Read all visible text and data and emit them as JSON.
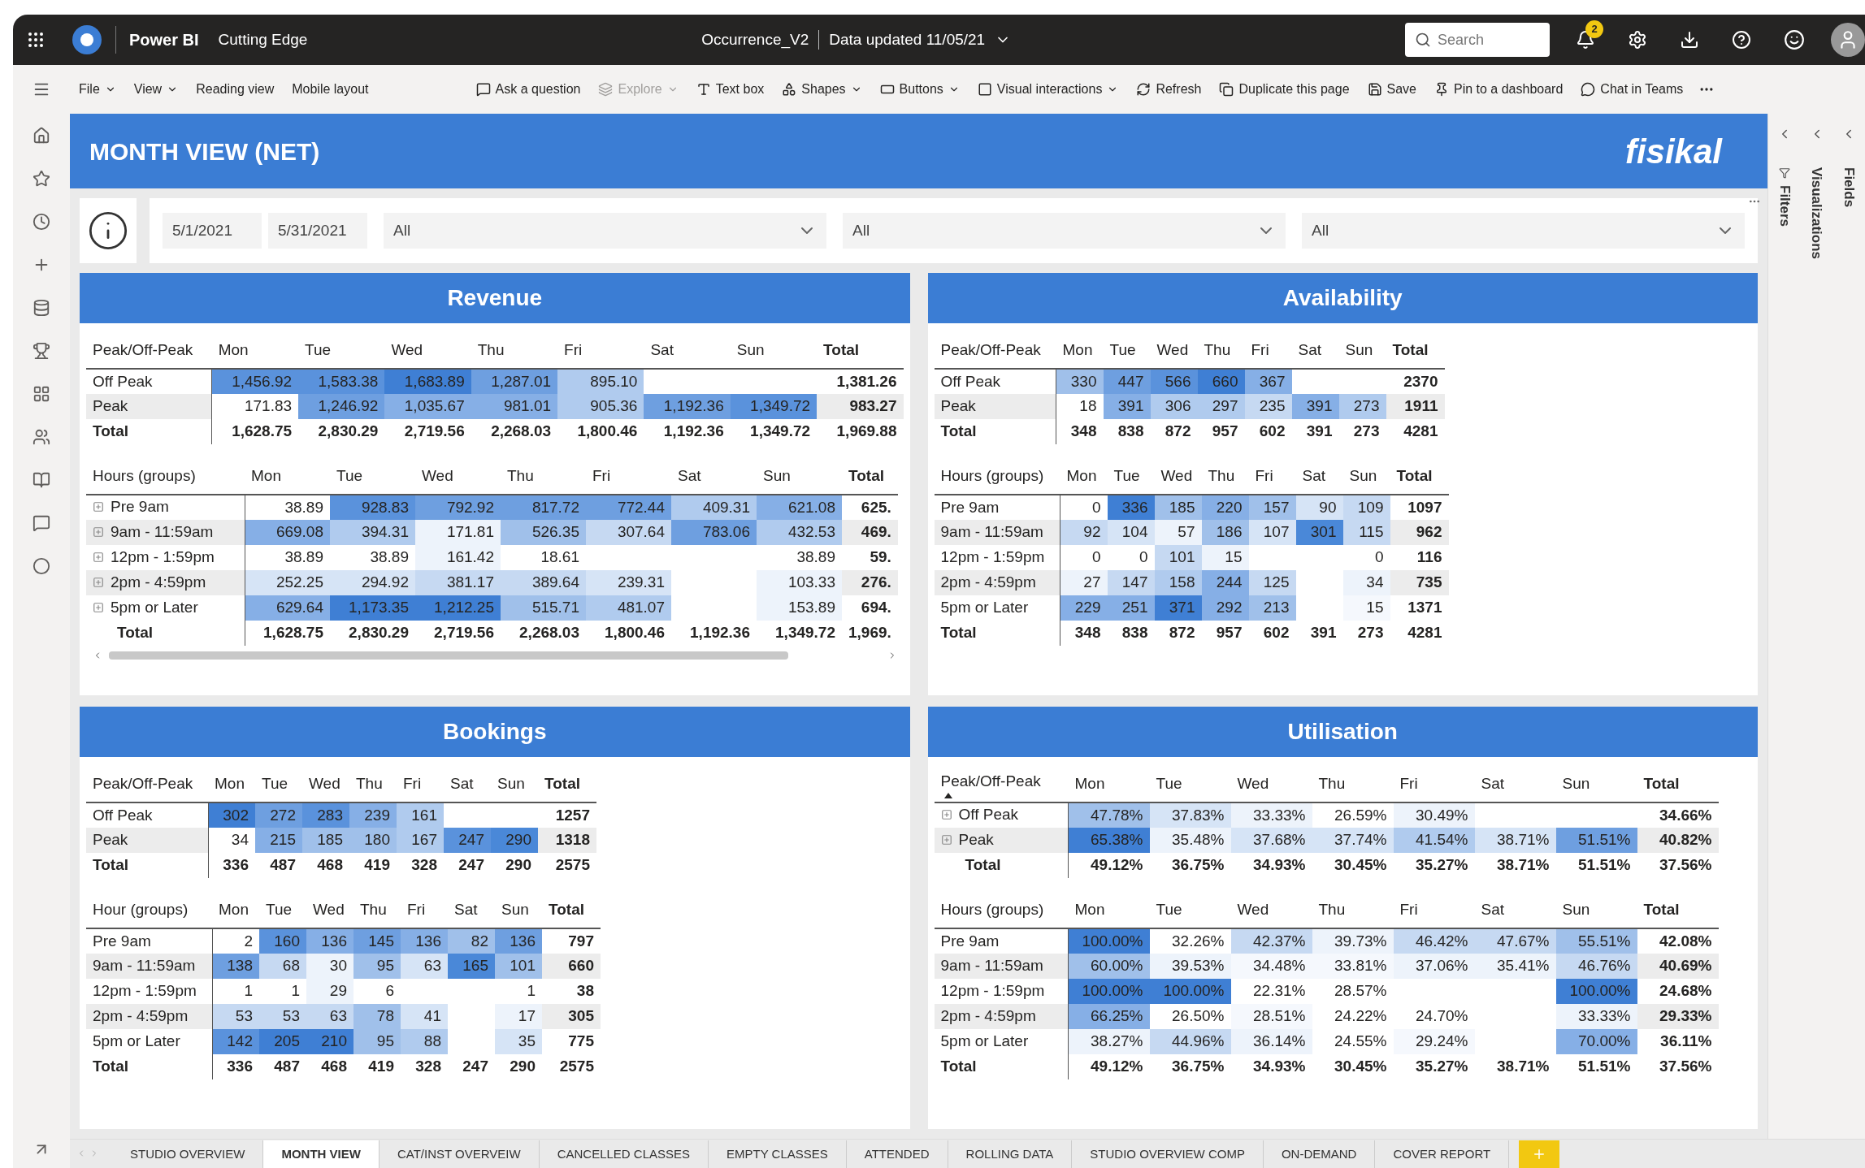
{
  "app_bar": {
    "app_name": "Power BI",
    "workspace": "Cutting Edge",
    "report_title": "Occurrence_V2",
    "data_updated": "Data updated 11/05/21",
    "search_placeholder": "Search",
    "notification_count": "2"
  },
  "toolbar": [
    {
      "label": "File",
      "dropdown": true,
      "disabled": false,
      "kind": "menu"
    },
    {
      "label": "View",
      "dropdown": true,
      "disabled": false,
      "kind": "menu"
    },
    {
      "label": "Reading view",
      "dropdown": false,
      "disabled": false,
      "kind": "menu"
    },
    {
      "label": "Mobile layout",
      "dropdown": false,
      "disabled": false,
      "kind": "menu"
    },
    {
      "label": "Ask a question",
      "dropdown": false,
      "disabled": false,
      "kind": "ask"
    },
    {
      "label": "Explore",
      "dropdown": true,
      "disabled": true,
      "kind": "explore"
    },
    {
      "label": "Text box",
      "dropdown": false,
      "disabled": false,
      "kind": "textbox"
    },
    {
      "label": "Shapes",
      "dropdown": true,
      "disabled": false,
      "kind": "shapes"
    },
    {
      "label": "Buttons",
      "dropdown": true,
      "disabled": false,
      "kind": "buttons"
    },
    {
      "label": "Visual interactions",
      "dropdown": true,
      "disabled": false,
      "kind": "interactions"
    },
    {
      "label": "Refresh",
      "dropdown": false,
      "disabled": false,
      "kind": "refresh"
    },
    {
      "label": "Duplicate this page",
      "dropdown": false,
      "disabled": false,
      "kind": "duplicate"
    },
    {
      "label": "Save",
      "dropdown": false,
      "disabled": false,
      "kind": "save"
    },
    {
      "label": "Pin to a dashboard",
      "dropdown": false,
      "disabled": false,
      "kind": "pin"
    },
    {
      "label": "Chat in Teams",
      "dropdown": false,
      "disabled": false,
      "kind": "teams"
    }
  ],
  "report_header": {
    "title": "MONTH VIEW (NET)",
    "logo": "fisikal"
  },
  "filters": {
    "start_date": "5/1/2021",
    "end_date": "5/31/2021",
    "dropdowns": [
      "All",
      "All",
      "All"
    ]
  },
  "panels": [
    {
      "title": "Revenue",
      "tables": [
        {
          "columns": [
            "Peak/Off-Peak",
            "Mon",
            "Tue",
            "Wed",
            "Thu",
            "Fri",
            "Sat",
            "Sun",
            "Total"
          ],
          "expand_icons": false,
          "sort_indicator": false,
          "scrollbar": false,
          "rows": [
            {
              "cells": [
                {
                  "text": "Off Peak"
                },
                {
                  "text": "1,456.92",
                  "color": "#5a92dc"
                },
                {
                  "text": "1,583.38",
                  "color": "#5a92dc"
                },
                {
                  "text": "1,683.89",
                  "color": "#3f7fd4"
                },
                {
                  "text": "1,287.01",
                  "color": "#6e9fe0"
                },
                {
                  "text": "895.10",
                  "color": "#b0cbee"
                },
                "",
                "",
                {
                  "text": "1,381.26"
                }
              ]
            },
            {
              "cells": [
                {
                  "text": "Peak"
                },
                {
                  "text": "171.83"
                },
                {
                  "text": "1,246.92",
                  "color": "#6e9fe0"
                },
                {
                  "text": "1,035.67",
                  "color": "#86afe6"
                },
                {
                  "text": "981.01",
                  "color": "#86afe6"
                },
                {
                  "text": "905.36",
                  "color": "#b0cbee"
                },
                {
                  "text": "1,192.36",
                  "color": "#6e9fe0"
                },
                {
                  "text": "1,349.72",
                  "color": "#5a92dc"
                },
                {
                  "text": "983.27"
                }
              ]
            }
          ],
          "total_row": [
            "Total",
            "1,628.75",
            "2,830.29",
            "2,719.56",
            "2,268.03",
            "1,800.46",
            "1,192.36",
            "1,349.72",
            "1,969.88"
          ]
        },
        {
          "columns": [
            "Hours (groups)",
            "Mon",
            "Tue",
            "Wed",
            "Thu",
            "Fri",
            "Sat",
            "Sun",
            "Total"
          ],
          "expand_icons": true,
          "sort_indicator": false,
          "scrollbar": true,
          "rows": [
            {
              "cells": [
                {
                  "text": "Pre 9am"
                },
                {
                  "text": "38.89"
                },
                {
                  "text": "928.83",
                  "color": "#5a92dc"
                },
                {
                  "text": "792.92",
                  "color": "#6e9fe0"
                },
                {
                  "text": "817.72",
                  "color": "#6e9fe0"
                },
                {
                  "text": "772.44",
                  "color": "#6e9fe0"
                },
                {
                  "text": "409.31",
                  "color": "#b0cbee"
                },
                {
                  "text": "621.08",
                  "color": "#86afe6"
                },
                {
                  "text": "625."
                }
              ]
            },
            {
              "cells": [
                {
                  "text": "9am - 11:59am"
                },
                {
                  "text": "669.08",
                  "color": "#86afe6"
                },
                {
                  "text": "394.31",
                  "color": "#b0cbee"
                },
                {
                  "text": "171.81",
                  "color": "#edf3fb"
                },
                {
                  "text": "526.35",
                  "color": "#a0c0ea"
                },
                {
                  "text": "307.64",
                  "color": "#c6d9f2"
                },
                {
                  "text": "783.06",
                  "color": "#6e9fe0"
                },
                {
                  "text": "432.53",
                  "color": "#b0cbee"
                },
                {
                  "text": "469."
                }
              ]
            },
            {
              "cells": [
                {
                  "text": "12pm - 1:59pm"
                },
                {
                  "text": "38.89"
                },
                {
                  "text": "38.89"
                },
                {
                  "text": "161.42",
                  "color": "#edf3fb"
                },
                {
                  "text": "18.61"
                },
                "",
                "",
                {
                  "text": "38.89"
                },
                {
                  "text": "59."
                }
              ]
            },
            {
              "cells": [
                {
                  "text": "2pm - 4:59pm"
                },
                {
                  "text": "252.25",
                  "color": "#d6e4f6"
                },
                {
                  "text": "294.92",
                  "color": "#d6e4f6"
                },
                {
                  "text": "381.17",
                  "color": "#c6d9f2"
                },
                {
                  "text": "389.64",
                  "color": "#c6d9f2"
                },
                {
                  "text": "239.31",
                  "color": "#d6e4f6"
                },
                "",
                {
                  "text": "103.33",
                  "color": "#edf3fb"
                },
                {
                  "text": "276."
                }
              ]
            },
            {
              "cells": [
                {
                  "text": "5pm or Later"
                },
                {
                  "text": "629.64",
                  "color": "#86afe6"
                },
                {
                  "text": "1,173.35",
                  "color": "#3f7fd4"
                },
                {
                  "text": "1,212.25",
                  "color": "#3f7fd4"
                },
                {
                  "text": "515.71",
                  "color": "#a0c0ea"
                },
                {
                  "text": "481.07",
                  "color": "#b0cbee"
                },
                "",
                {
                  "text": "153.89",
                  "color": "#edf3fb"
                },
                {
                  "text": "694."
                }
              ]
            }
          ],
          "total_row": [
            "Total",
            "1,628.75",
            "2,830.29",
            "2,719.56",
            "2,268.03",
            "1,800.46",
            "1,192.36",
            "1,349.72",
            "1,969."
          ]
        }
      ]
    },
    {
      "title": "Availability",
      "tables": [
        {
          "columns": [
            "Peak/Off-Peak",
            "Mon",
            "Tue",
            "Wed",
            "Thu",
            "Fri",
            "Sat",
            "Sun",
            "Total"
          ],
          "expand_icons": false,
          "sort_indicator": false,
          "scrollbar": false,
          "rows": [
            {
              "cells": [
                {
                  "text": "Off Peak"
                },
                {
                  "text": "330",
                  "color": "#a0c0ea"
                },
                {
                  "text": "447",
                  "color": "#6e9fe0"
                },
                {
                  "text": "566",
                  "color": "#5a92dc"
                },
                {
                  "text": "660",
                  "color": "#3f7fd4"
                },
                {
                  "text": "367",
                  "color": "#86afe6"
                },
                "",
                "",
                {
                  "text": "2370"
                }
              ]
            },
            {
              "cells": [
                {
                  "text": "Peak"
                },
                {
                  "text": "18"
                },
                {
                  "text": "391",
                  "color": "#86afe6"
                },
                {
                  "text": "306",
                  "color": "#b0cbee"
                },
                {
                  "text": "297",
                  "color": "#b0cbee"
                },
                {
                  "text": "235",
                  "color": "#c6d9f2"
                },
                {
                  "text": "391",
                  "color": "#86afe6"
                },
                {
                  "text": "273",
                  "color": "#b0cbee"
                },
                {
                  "text": "1911"
                }
              ]
            }
          ],
          "total_row": [
            "Total",
            "348",
            "838",
            "872",
            "957",
            "602",
            "391",
            "273",
            "4281"
          ]
        },
        {
          "columns": [
            "Hours (groups)",
            "Mon",
            "Tue",
            "Wed",
            "Thu",
            "Fri",
            "Sat",
            "Sun",
            "Total"
          ],
          "expand_icons": false,
          "sort_indicator": false,
          "scrollbar": false,
          "rows": [
            {
              "cells": [
                {
                  "text": "Pre 9am"
                },
                {
                  "text": "0"
                },
                {
                  "text": "336",
                  "color": "#3f7fd4"
                },
                {
                  "text": "185",
                  "color": "#a0c0ea"
                },
                {
                  "text": "220",
                  "color": "#86afe6"
                },
                {
                  "text": "157",
                  "color": "#a0c0ea"
                },
                {
                  "text": "90",
                  "color": "#d6e4f6"
                },
                {
                  "text": "109",
                  "color": "#c6d9f2"
                },
                {
                  "text": "1097"
                }
              ]
            },
            {
              "cells": [
                {
                  "text": "9am - 11:59am"
                },
                {
                  "text": "92",
                  "color": "#c6d9f2"
                },
                {
                  "text": "104",
                  "color": "#d6e4f6"
                },
                {
                  "text": "57",
                  "color": "#edf3fb"
                },
                {
                  "text": "186",
                  "color": "#a0c0ea"
                },
                {
                  "text": "107",
                  "color": "#d6e4f6"
                },
                {
                  "text": "301",
                  "color": "#4a88d8"
                },
                {
                  "text": "115",
                  "color": "#c6d9f2"
                },
                {
                  "text": "962"
                }
              ]
            },
            {
              "cells": [
                {
                  "text": "12pm - 1:59pm"
                },
                {
                  "text": "0"
                },
                {
                  "text": "0"
                },
                {
                  "text": "101",
                  "color": "#c6d9f2"
                },
                {
                  "text": "15",
                  "color": "#edf3fb"
                },
                "",
                "",
                {
                  "text": "0"
                },
                {
                  "text": "116"
                }
              ]
            },
            {
              "cells": [
                {
                  "text": "2pm - 4:59pm"
                },
                {
                  "text": "27",
                  "color": "#edf3fb"
                },
                {
                  "text": "147",
                  "color": "#c6d9f2"
                },
                {
                  "text": "158",
                  "color": "#b0cbee"
                },
                {
                  "text": "244",
                  "color": "#86afe6"
                },
                {
                  "text": "125",
                  "color": "#c6d9f2"
                },
                "",
                {
                  "text": "34",
                  "color": "#edf3fb"
                },
                {
                  "text": "735"
                }
              ]
            },
            {
              "cells": [
                {
                  "text": "5pm or Later"
                },
                {
                  "text": "229",
                  "color": "#86afe6"
                },
                {
                  "text": "251",
                  "color": "#86afe6"
                },
                {
                  "text": "371",
                  "color": "#3f7fd4"
                },
                {
                  "text": "292",
                  "color": "#86afe6"
                },
                {
                  "text": "213",
                  "color": "#a0c0ea"
                },
                "",
                {
                  "text": "15",
                  "color": "#f5f8fd"
                },
                {
                  "text": "1371"
                }
              ]
            }
          ],
          "total_row": [
            "Total",
            "348",
            "838",
            "872",
            "957",
            "602",
            "391",
            "273",
            "4281"
          ]
        }
      ]
    },
    {
      "title": "Bookings",
      "tables": [
        {
          "columns": [
            "Peak/Off-Peak",
            "Mon",
            "Tue",
            "Wed",
            "Thu",
            "Fri",
            "Sat",
            "Sun",
            "Total"
          ],
          "expand_icons": false,
          "sort_indicator": false,
          "scrollbar": false,
          "rows": [
            {
              "cells": [
                {
                  "text": "Off Peak"
                },
                {
                  "text": "302",
                  "color": "#3f7fd4"
                },
                {
                  "text": "272",
                  "color": "#6e9fe0"
                },
                {
                  "text": "283",
                  "color": "#5a92dc"
                },
                {
                  "text": "239",
                  "color": "#86afe6"
                },
                {
                  "text": "161",
                  "color": "#b0cbee"
                },
                "",
                "",
                {
                  "text": "1257"
                }
              ]
            },
            {
              "cells": [
                {
                  "text": "Peak"
                },
                {
                  "text": "34"
                },
                {
                  "text": "215",
                  "color": "#86afe6"
                },
                {
                  "text": "185",
                  "color": "#a0c0ea"
                },
                {
                  "text": "180",
                  "color": "#a0c0ea"
                },
                {
                  "text": "167",
                  "color": "#b0cbee"
                },
                {
                  "text": "247",
                  "color": "#5a92dc"
                },
                {
                  "text": "290",
                  "color": "#4a88d8"
                },
                {
                  "text": "1318"
                }
              ]
            }
          ],
          "total_row": [
            "Total",
            "336",
            "487",
            "468",
            "419",
            "328",
            "247",
            "290",
            "2575"
          ]
        },
        {
          "columns": [
            "Hour (groups)",
            "Mon",
            "Tue",
            "Wed",
            "Thu",
            "Fri",
            "Sat",
            "Sun",
            "Total"
          ],
          "expand_icons": false,
          "sort_indicator": false,
          "scrollbar": false,
          "rows": [
            {
              "cells": [
                {
                  "text": "Pre 9am"
                },
                {
                  "text": "2"
                },
                {
                  "text": "160",
                  "color": "#5a92dc"
                },
                {
                  "text": "136",
                  "color": "#86afe6"
                },
                {
                  "text": "145",
                  "color": "#6e9fe0"
                },
                {
                  "text": "136",
                  "color": "#86afe6"
                },
                {
                  "text": "82",
                  "color": "#a0c0ea"
                },
                {
                  "text": "136",
                  "color": "#6e9fe0"
                },
                {
                  "text": "797"
                }
              ]
            },
            {
              "cells": [
                {
                  "text": "9am - 11:59am"
                },
                {
                  "text": "138",
                  "color": "#6e9fe0"
                },
                {
                  "text": "68",
                  "color": "#c6d9f2"
                },
                {
                  "text": "30",
                  "color": "#edf3fb"
                },
                {
                  "text": "95",
                  "color": "#a0c0ea"
                },
                {
                  "text": "63",
                  "color": "#d6e4f6"
                },
                {
                  "text": "165",
                  "color": "#4a88d8"
                },
                {
                  "text": "101",
                  "color": "#a0c0ea"
                },
                {
                  "text": "660"
                }
              ]
            },
            {
              "cells": [
                {
                  "text": "12pm - 1:59pm"
                },
                {
                  "text": "1"
                },
                {
                  "text": "1"
                },
                {
                  "text": "29",
                  "color": "#edf3fb"
                },
                {
                  "text": "6"
                },
                "",
                "",
                {
                  "text": "1"
                },
                {
                  "text": "38"
                }
              ]
            },
            {
              "cells": [
                {
                  "text": "2pm - 4:59pm"
                },
                {
                  "text": "53",
                  "color": "#c6d9f2"
                },
                {
                  "text": "53",
                  "color": "#c6d9f2"
                },
                {
                  "text": "63",
                  "color": "#c6d9f2"
                },
                {
                  "text": "78",
                  "color": "#a0c0ea"
                },
                {
                  "text": "41",
                  "color": "#d6e4f6"
                },
                "",
                {
                  "text": "17",
                  "color": "#edf3fb"
                },
                {
                  "text": "305"
                }
              ]
            },
            {
              "cells": [
                {
                  "text": "5pm or Later"
                },
                {
                  "text": "142",
                  "color": "#5a92dc"
                },
                {
                  "text": "205",
                  "color": "#3f7fd4"
                },
                {
                  "text": "210",
                  "color": "#3f7fd4"
                },
                {
                  "text": "95",
                  "color": "#a0c0ea"
                },
                {
                  "text": "88",
                  "color": "#b0cbee"
                },
                "",
                {
                  "text": "35",
                  "color": "#d6e4f6"
                },
                {
                  "text": "775"
                }
              ]
            }
          ],
          "total_row": [
            "Total",
            "336",
            "487",
            "468",
            "419",
            "328",
            "247",
            "290",
            "2575"
          ]
        }
      ]
    },
    {
      "title": "Utilisation",
      "tables": [
        {
          "columns": [
            "Peak/Off-Peak",
            "Mon",
            "Tue",
            "Wed",
            "Thu",
            "Fri",
            "Sat",
            "Sun",
            "Total"
          ],
          "expand_icons": true,
          "sort_indicator": true,
          "scrollbar": false,
          "rows": [
            {
              "cells": [
                {
                  "text": "Off Peak"
                },
                {
                  "text": "47.78%",
                  "color": "#a0c0ea"
                },
                {
                  "text": "37.83%",
                  "color": "#d6e4f6"
                },
                {
                  "text": "33.33%",
                  "color": "#edf3fb"
                },
                {
                  "text": "26.59%"
                },
                {
                  "text": "30.49%",
                  "color": "#edf3fb"
                },
                "",
                "",
                {
                  "text": "34.66%"
                }
              ]
            },
            {
              "cells": [
                {
                  "text": "Peak"
                },
                {
                  "text": "65.38%",
                  "color": "#3f7fd4"
                },
                {
                  "text": "35.48%",
                  "color": "#edf3fb"
                },
                {
                  "text": "37.68%",
                  "color": "#d6e4f6"
                },
                {
                  "text": "37.74%",
                  "color": "#d6e4f6"
                },
                {
                  "text": "41.54%",
                  "color": "#b0cbee"
                },
                {
                  "text": "38.71%",
                  "color": "#d6e4f6"
                },
                {
                  "text": "51.51%",
                  "color": "#6e9fe0"
                },
                {
                  "text": "40.82%"
                }
              ]
            }
          ],
          "total_row": [
            "Total",
            "49.12%",
            "36.75%",
            "34.93%",
            "30.45%",
            "35.27%",
            "38.71%",
            "51.51%",
            "37.56%"
          ]
        },
        {
          "columns": [
            "Hours (groups)",
            "Mon",
            "Tue",
            "Wed",
            "Thu",
            "Fri",
            "Sat",
            "Sun",
            "Total"
          ],
          "expand_icons": false,
          "sort_indicator": false,
          "scrollbar": false,
          "rows": [
            {
              "cells": [
                {
                  "text": "Pre 9am"
                },
                {
                  "text": "100.00%",
                  "color": "#3f7fd4"
                },
                {
                  "text": "32.26%"
                },
                {
                  "text": "42.37%",
                  "color": "#c6d9f2"
                },
                {
                  "text": "39.73%",
                  "color": "#edf3fb"
                },
                {
                  "text": "46.42%",
                  "color": "#c6d9f2"
                },
                {
                  "text": "47.67%",
                  "color": "#c6d9f2"
                },
                {
                  "text": "55.51%",
                  "color": "#a0c0ea"
                },
                {
                  "text": "42.08%"
                }
              ]
            },
            {
              "cells": [
                {
                  "text": "9am - 11:59am"
                },
                {
                  "text": "60.00%",
                  "color": "#a0c0ea"
                },
                {
                  "text": "39.53%",
                  "color": "#edf3fb"
                },
                {
                  "text": "34.48%",
                  "color": "#f5f8fd"
                },
                {
                  "text": "33.81%",
                  "color": "#f5f8fd"
                },
                {
                  "text": "37.06%",
                  "color": "#edf3fb"
                },
                {
                  "text": "35.41%",
                  "color": "#edf3fb"
                },
                {
                  "text": "46.76%",
                  "color": "#c6d9f2"
                },
                {
                  "text": "40.69%"
                }
              ]
            },
            {
              "cells": [
                {
                  "text": "12pm - 1:59pm"
                },
                {
                  "text": "100.00%",
                  "color": "#3f7fd4"
                },
                {
                  "text": "100.00%",
                  "color": "#3f7fd4"
                },
                {
                  "text": "22.31%"
                },
                {
                  "text": "28.57%"
                },
                "",
                "",
                {
                  "text": "100.00%",
                  "color": "#3f7fd4"
                },
                {
                  "text": "24.68%"
                }
              ]
            },
            {
              "cells": [
                {
                  "text": "2pm - 4:59pm"
                },
                {
                  "text": "66.25%",
                  "color": "#86afe6"
                },
                {
                  "text": "26.50%"
                },
                {
                  "text": "28.51%",
                  "color": "#f5f8fd"
                },
                {
                  "text": "24.22%"
                },
                {
                  "text": "24.70%"
                },
                "",
                {
                  "text": "33.33%",
                  "color": "#edf3fb"
                },
                {
                  "text": "29.33%"
                }
              ]
            },
            {
              "cells": [
                {
                  "text": "5pm or Later"
                },
                {
                  "text": "38.27%",
                  "color": "#edf3fb"
                },
                {
                  "text": "44.96%",
                  "color": "#c6d9f2"
                },
                {
                  "text": "36.14%",
                  "color": "#edf3fb"
                },
                {
                  "text": "24.55%"
                },
                {
                  "text": "29.24%",
                  "color": "#f5f8fd"
                },
                "",
                {
                  "text": "70.00%",
                  "color": "#86afe6"
                },
                {
                  "text": "36.11%"
                }
              ]
            }
          ],
          "total_row": [
            "Total",
            "49.12%",
            "36.75%",
            "34.93%",
            "30.45%",
            "35.27%",
            "38.71%",
            "51.51%",
            "37.56%"
          ]
        }
      ]
    }
  ],
  "side_panes": [
    "Filters",
    "Visualizations",
    "Fields"
  ],
  "page_tabs": [
    {
      "label": "STUDIO OVERVIEW",
      "selected": false
    },
    {
      "label": "MONTH VIEW",
      "selected": true
    },
    {
      "label": "CAT/INST OVERVEIW",
      "selected": false
    },
    {
      "label": "CANCELLED CLASSES",
      "selected": false
    },
    {
      "label": "EMPTY CLASSES",
      "selected": false
    },
    {
      "label": "ATTENDED",
      "selected": false
    },
    {
      "label": "ROLLING DATA",
      "selected": false
    },
    {
      "label": "STUDIO OVERVIEW COMP",
      "selected": false
    },
    {
      "label": "ON-DEMAND",
      "selected": false
    },
    {
      "label": "COVER REPORT",
      "selected": false
    }
  ]
}
